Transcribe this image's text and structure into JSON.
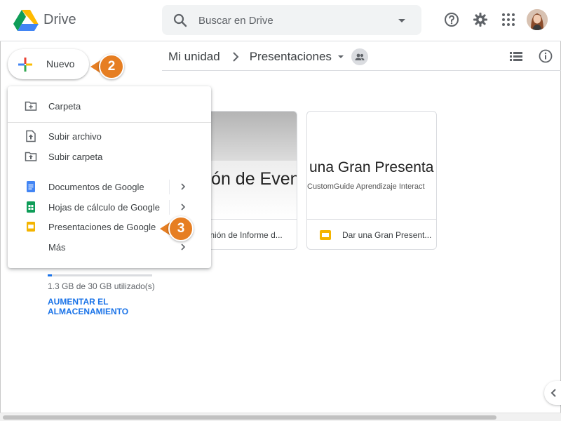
{
  "header": {
    "app_name": "Drive",
    "search_placeholder": "Buscar en Drive",
    "icons": [
      "help-icon",
      "settings-icon",
      "apps-grid-icon"
    ]
  },
  "new_button": {
    "label": "Nuevo"
  },
  "breadcrumb": {
    "root": "Mi unidad",
    "current": "Presentaciones"
  },
  "new_menu": {
    "items": [
      {
        "label": "Carpeta",
        "icon": "new-folder-icon"
      },
      {
        "label": "Subir archivo",
        "icon": "file-upload-icon"
      },
      {
        "label": "Subir carpeta",
        "icon": "folder-upload-icon"
      },
      {
        "label": "Documentos de Google",
        "icon": "google-docs-icon"
      },
      {
        "label": "Hojas de cálculo de Google",
        "icon": "google-sheets-icon"
      },
      {
        "label": "Presentaciones de Google",
        "icon": "google-slides-icon"
      },
      {
        "label": "Más"
      }
    ]
  },
  "files": [
    {
      "thumb_title": "ción de Evento",
      "name": "eunión de Informe d..."
    },
    {
      "thumb_title": "una Gran Presenta",
      "thumb_subtitle": "CustomGuide Aprendizaje Interact",
      "name": "Dar una Gran Present..."
    }
  ],
  "storage": {
    "used_text": "1.3 GB de 30 GB utilizado(s)",
    "used_fraction": 0.043,
    "upgrade_link": "AUMENTAR EL ALMACENAMIENTO"
  },
  "callouts": {
    "step_new": "2",
    "step_slides": "3"
  },
  "colors": {
    "callout": "#e67e22",
    "accent_blue": "#1a73e8",
    "slides_yellow": "#f4b400",
    "sheets_green": "#0f9d58",
    "docs_blue": "#4285f4"
  }
}
